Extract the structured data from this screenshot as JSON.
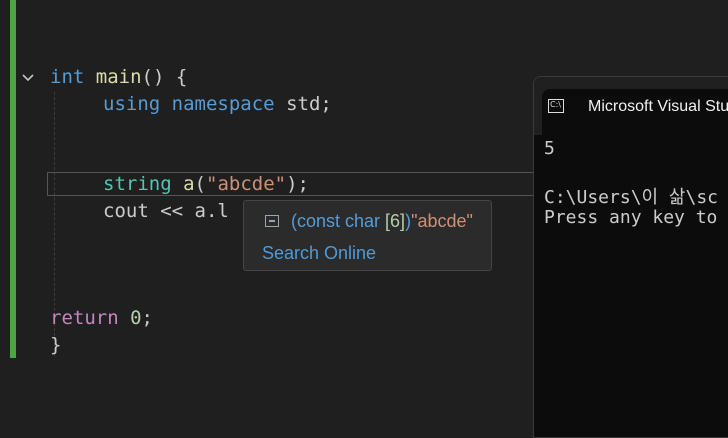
{
  "editor": {
    "lines": {
      "l1": {
        "int": "int",
        "main": "main",
        "rest": "() {"
      },
      "l2": {
        "using": "using",
        "namespace": "namespace",
        "std": "std",
        "semi": ";"
      },
      "l3": {
        "string": "string",
        "a": "a",
        "open": "(",
        "str": "\"abcde\"",
        "close": ");"
      },
      "l4": {
        "text": "cout << a.l"
      },
      "l5": {
        "ret": "return",
        "zero": "0",
        "semi": ";"
      },
      "l6": {
        "brace": "}"
      }
    }
  },
  "tooltip": {
    "signature_prefix": "(const char ",
    "size": "[6]",
    "signature_suffix": ")",
    "value": "\"abcde\"",
    "search_link": "Search Online"
  },
  "console": {
    "title": "Microsoft Visual Studio Debug Console",
    "icon_text": "C:\\",
    "output": [
      "5",
      "C:\\Users\\이 삶\\sc",
      "Press any key to"
    ]
  },
  "colors": {
    "change_bar": "#4aa840",
    "editor_bg": "#1f1f1f",
    "keyword": "#569cd6",
    "string": "#ce9178"
  }
}
